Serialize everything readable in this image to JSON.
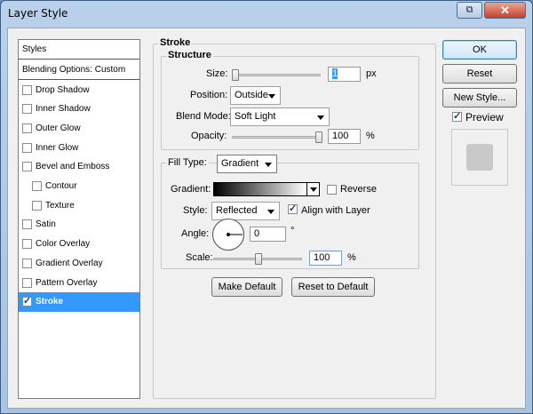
{
  "window": {
    "title": "Layer Style",
    "help_glyph": "⧉",
    "close_glyph": "✕"
  },
  "styles_panel": {
    "header": "Styles",
    "blending": "Blending Options: Custom",
    "items": [
      {
        "label": "Drop Shadow",
        "checked": false,
        "selected": false,
        "sub": false
      },
      {
        "label": "Inner Shadow",
        "checked": false,
        "selected": false,
        "sub": false
      },
      {
        "label": "Outer Glow",
        "checked": false,
        "selected": false,
        "sub": false
      },
      {
        "label": "Inner Glow",
        "checked": false,
        "selected": false,
        "sub": false
      },
      {
        "label": "Bevel and Emboss",
        "checked": false,
        "selected": false,
        "sub": false
      },
      {
        "label": "Contour",
        "checked": false,
        "selected": false,
        "sub": true
      },
      {
        "label": "Texture",
        "checked": false,
        "selected": false,
        "sub": true
      },
      {
        "label": "Satin",
        "checked": false,
        "selected": false,
        "sub": false
      },
      {
        "label": "Color Overlay",
        "checked": false,
        "selected": false,
        "sub": false
      },
      {
        "label": "Gradient Overlay",
        "checked": false,
        "selected": false,
        "sub": false
      },
      {
        "label": "Pattern Overlay",
        "checked": false,
        "selected": false,
        "sub": false
      },
      {
        "label": "Stroke",
        "checked": true,
        "selected": true,
        "sub": false
      }
    ]
  },
  "stroke": {
    "title": "Stroke",
    "structure_title": "Structure",
    "size_label": "Size:",
    "size_value": "1",
    "size_unit": "px",
    "size_level": 0.0,
    "position_label": "Position:",
    "position_value": "Outside",
    "blend_label": "Blend Mode:",
    "blend_value": "Soft Light",
    "opacity_label": "Opacity:",
    "opacity_value": "100",
    "opacity_unit": "%",
    "opacity_level": 1.0,
    "fill_type_label": "Fill Type:",
    "fill_type_value": "Gradient",
    "gradient_label": "Gradient:",
    "reverse_label": "Reverse",
    "reverse_checked": false,
    "style_label": "Style:",
    "style_value": "Reflected",
    "align_label": "Align with Layer",
    "align_checked": true,
    "angle_label": "Angle:",
    "angle_value": "0",
    "angle_unit": "°",
    "scale_label": "Scale:",
    "scale_value": "100",
    "scale_unit": "%",
    "scale_level": 0.5,
    "make_default": "Make Default",
    "reset_default": "Reset to Default"
  },
  "actions": {
    "ok": "OK",
    "reset": "Reset",
    "new_style": "New Style...",
    "preview_label": "Preview",
    "preview_checked": true
  },
  "colors": {
    "selection": "#3399ff",
    "window_frame": "#b9d1ea",
    "dialog_bg": "#f0f0f0"
  }
}
